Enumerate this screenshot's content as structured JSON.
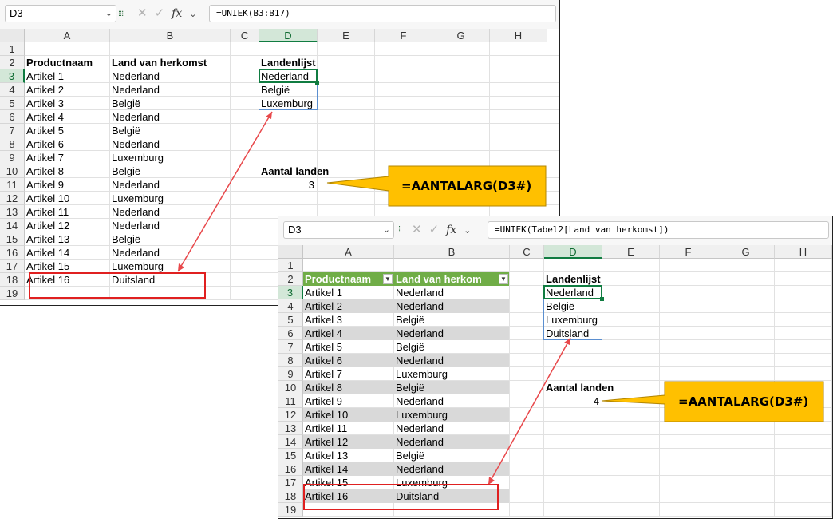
{
  "window1": {
    "name_box": "D3",
    "formula": "=UNIEK(B3:B17)",
    "columns": [
      "A",
      "B",
      "C",
      "D",
      "E",
      "F",
      "G",
      "H"
    ],
    "rows": [
      "1",
      "2",
      "3",
      "4",
      "5",
      "6",
      "7",
      "8",
      "9",
      "10",
      "11",
      "12",
      "13",
      "14",
      "15",
      "16",
      "17",
      "18",
      "19"
    ],
    "header_a": "Productnaam",
    "header_b": "Land van herkomst",
    "products": [
      "Artikel 1",
      "Artikel 2",
      "Artikel 3",
      "Artikel 4",
      "Artikel 5",
      "Artikel 6",
      "Artikel 7",
      "Artikel 8",
      "Artikel 9",
      "Artikel 10",
      "Artikel 11",
      "Artikel 12",
      "Artikel 13",
      "Artikel 14",
      "Artikel 15",
      "Artikel 16"
    ],
    "countries": [
      "Nederland",
      "Nederland",
      "België",
      "Nederland",
      "België",
      "Nederland",
      "Luxemburg",
      "België",
      "Nederland",
      "Luxemburg",
      "Nederland",
      "Nederland",
      "België",
      "Nederland",
      "Luxemburg",
      "Duitsland"
    ],
    "list_header": "Landenlijst",
    "list": [
      "Nederland",
      "België",
      "Luxemburg"
    ],
    "count_label": "Aantal landen",
    "count_value": "3",
    "callout": "=AANTALARG(D3#)"
  },
  "window2": {
    "name_box": "D3",
    "formula": "=UNIEK(Tabel2[Land van herkomst])",
    "columns": [
      "A",
      "B",
      "C",
      "D",
      "E",
      "F",
      "G",
      "H"
    ],
    "rows": [
      "1",
      "2",
      "3",
      "4",
      "5",
      "6",
      "7",
      "8",
      "9",
      "10",
      "11",
      "12",
      "13",
      "14",
      "15",
      "16",
      "17",
      "18",
      "19"
    ],
    "header_a": "Productnaam",
    "header_b": "Land van herkom",
    "products": [
      "Artikel 1",
      "Artikel 2",
      "Artikel 3",
      "Artikel 4",
      "Artikel 5",
      "Artikel 6",
      "Artikel 7",
      "Artikel 8",
      "Artikel 9",
      "Artikel 10",
      "Artikel 11",
      "Artikel 12",
      "Artikel 13",
      "Artikel 14",
      "Artikel 15",
      "Artikel 16"
    ],
    "countries": [
      "Nederland",
      "Nederland",
      "België",
      "Nederland",
      "België",
      "Nederland",
      "Luxemburg",
      "België",
      "Nederland",
      "Luxemburg",
      "Nederland",
      "Nederland",
      "België",
      "Nederland",
      "Luxemburg",
      "Duitsland"
    ],
    "list_header": "Landenlijst",
    "list": [
      "Nederland",
      "België",
      "Luxemburg",
      "Duitsland"
    ],
    "count_label": "Aantal landen",
    "count_value": "4",
    "callout": "=AANTALARG(D3#)"
  },
  "icons": {
    "name_box_dropdown": "chevron-down-icon",
    "cancel": "close-icon",
    "enter": "check-icon",
    "function": "fx-icon",
    "expand_formula": "chevron-down-icon",
    "filter": "filter-dropdown-icon"
  },
  "colors": {
    "accent_green": "#107c41",
    "table_header": "#70ad47",
    "table_band": "#d9d9d9",
    "callout_fill": "#ffc000",
    "annotation_red": "#e02020",
    "spill_border": "#5b8fd0"
  }
}
